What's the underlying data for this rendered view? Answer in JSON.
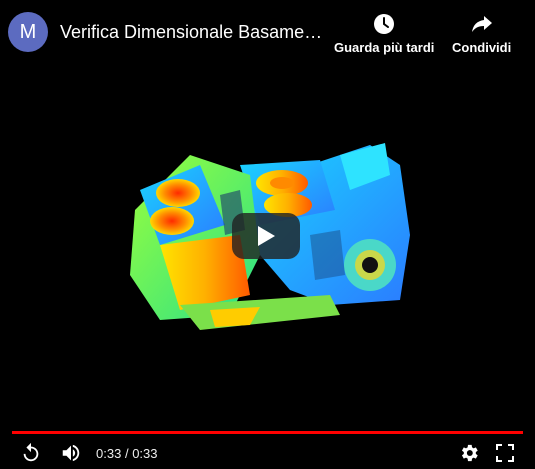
{
  "channel": {
    "avatar_letter": "M",
    "avatar_color": "#5c6bc0"
  },
  "video": {
    "title": "Verifica Dimensionale Basamen…"
  },
  "actions": {
    "watch_later_label": "Guarda più tardi",
    "watch_later_icon": "clock-icon",
    "share_label": "Condividi",
    "share_icon": "share-arrow-icon"
  },
  "player": {
    "current_time": "0:33",
    "separator": "/",
    "duration": "0:33",
    "progress_fraction": 1.0,
    "progress_color": "#ff0000",
    "controls": [
      "replay-icon",
      "volume-icon",
      "settings-gear-icon",
      "fullscreen-icon"
    ],
    "big_play_icon": "play-icon"
  }
}
